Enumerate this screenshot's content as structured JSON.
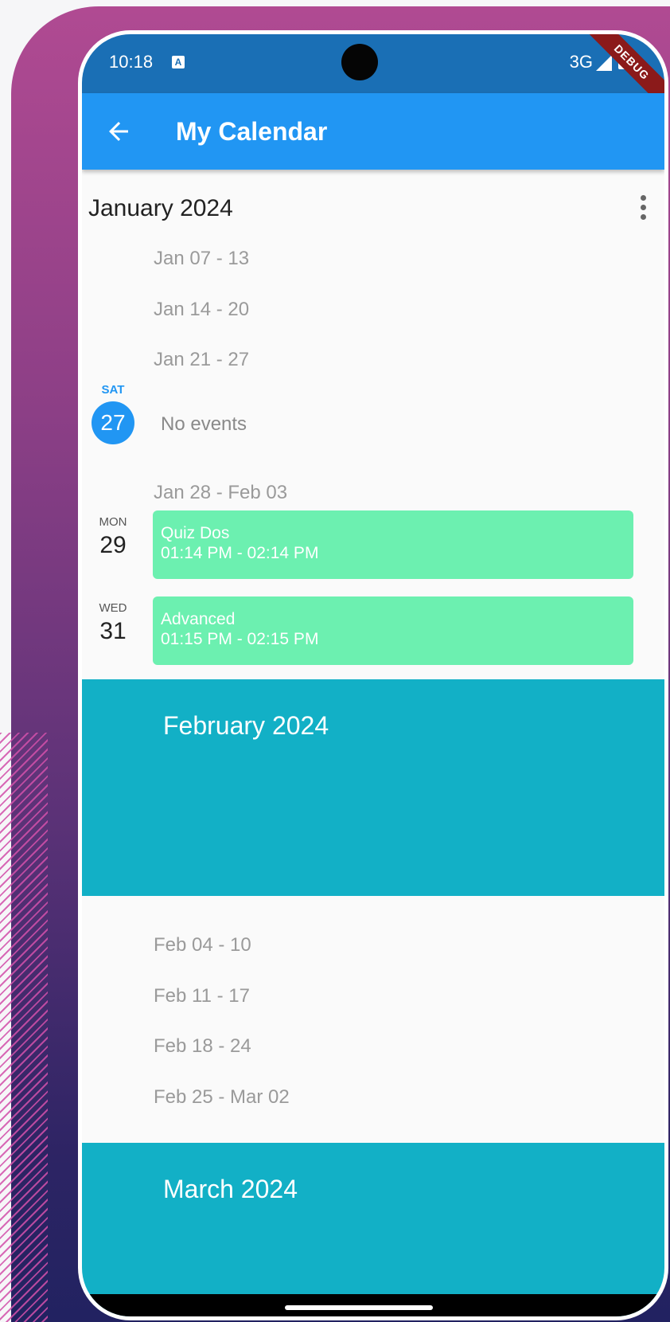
{
  "status_bar": {
    "time": "10:18",
    "notification_icon": "A",
    "network": "3G",
    "debug_label": "DEBUG"
  },
  "app_bar": {
    "title": "My Calendar",
    "back_icon": "arrow-left"
  },
  "january": {
    "title": "January 2024",
    "weeks": [
      "Jan 07 - 13",
      "Jan 14 - 20",
      "Jan 21 - 27",
      "Jan 28 - Feb 03"
    ],
    "today": {
      "day_name": "SAT",
      "day_num": "27",
      "empty_text": "No events"
    },
    "events": [
      {
        "day_name": "MON",
        "day_num": "29",
        "title": "Quiz Dos",
        "time": "01:14 PM - 02:14 PM"
      },
      {
        "day_name": "WED",
        "day_num": "31",
        "title": "Advanced",
        "time": "01:15 PM - 02:15 PM"
      }
    ]
  },
  "february": {
    "title": "February 2024",
    "weeks": [
      "Feb 04 - 10",
      "Feb 11 - 17",
      "Feb 18 - 24",
      "Feb 25 - Mar 02"
    ]
  },
  "march": {
    "title": "March 2024"
  },
  "colors": {
    "app_bar": "#2196f3",
    "status_bar": "#1a6fb5",
    "event_card": "#6cf0b0",
    "month_banner": "#12b0c6",
    "today_circle": "#2196f3"
  }
}
